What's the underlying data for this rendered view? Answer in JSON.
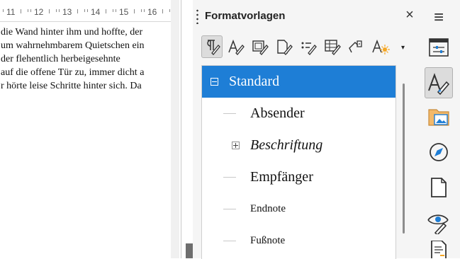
{
  "ruler": {
    "numbers": [
      "11",
      "12",
      "13",
      "14",
      "15",
      "16"
    ]
  },
  "document": {
    "lines": [
      "die Wand hinter ihm und hoffte, der",
      "um wahrnehmbarem Quietschen ein",
      "der flehentlich herbeigesehnte",
      "auf die offene Tür zu, immer dicht a",
      "r hörte leise Schritte hinter sich. Da"
    ]
  },
  "panel": {
    "title": "Formatvorlagen",
    "close_glyph": "×",
    "menu_glyph": "≡",
    "toolbar": {
      "buttons": [
        "paragraph-styles-icon",
        "character-styles-icon",
        "frame-styles-icon",
        "page-styles-icon",
        "list-styles-icon",
        "table-styles-icon",
        "fill-format-mode-icon",
        "new-style-icon"
      ],
      "dropdown_glyph": "▾"
    },
    "styles": [
      {
        "label": "Standard",
        "selected": true,
        "expander": "collapse"
      },
      {
        "label": "Absender"
      },
      {
        "label": "Beschriftung",
        "expander": "expand",
        "italic": true
      },
      {
        "label": "Empfänger"
      },
      {
        "label": "Endnote",
        "small": true
      },
      {
        "label": "Fußnote",
        "small": true
      }
    ]
  },
  "sidebar": {
    "buttons": [
      "properties-icon",
      "styles-icon",
      "gallery-icon",
      "navigator-icon",
      "page-icon",
      "style-inspector-icon",
      "manage-changes-icon"
    ],
    "active": "styles-icon"
  }
}
